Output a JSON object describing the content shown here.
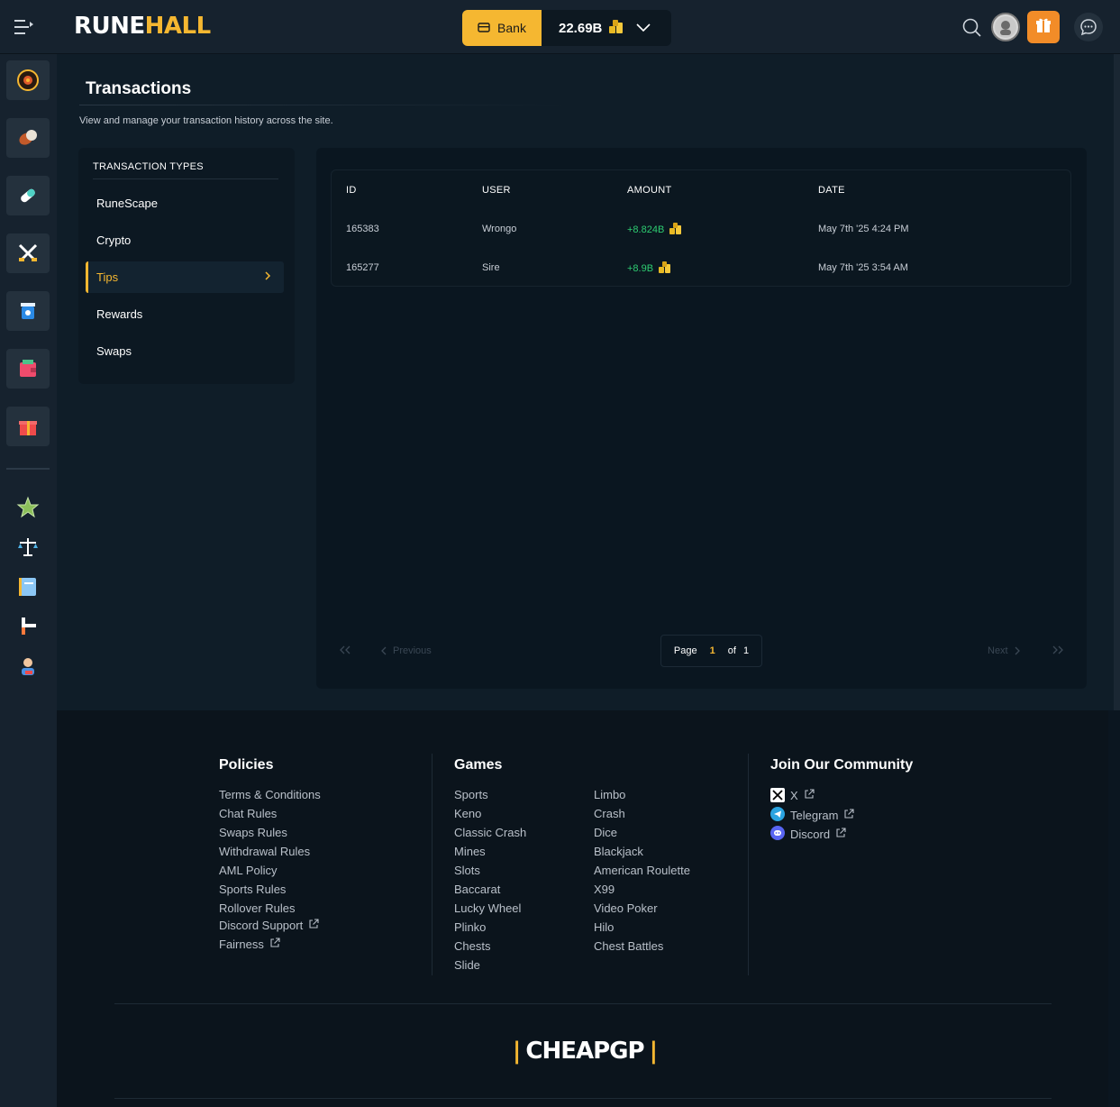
{
  "app": {
    "brand_first": "RUNE",
    "brand_second": "HALL"
  },
  "header": {
    "bank_label": "Bank",
    "balance": "22.69B"
  },
  "page": {
    "title": "Transactions",
    "subtitle": "View and manage your transaction history across the site."
  },
  "transaction_types": {
    "heading": "TRANSACTION TYPES",
    "items": [
      {
        "label": "RuneScape"
      },
      {
        "label": "Crypto"
      },
      {
        "label": "Tips"
      },
      {
        "label": "Rewards"
      },
      {
        "label": "Swaps"
      }
    ],
    "active": "Tips"
  },
  "table": {
    "columns": [
      "ID",
      "USER",
      "AMOUNT",
      "DATE"
    ],
    "rows": [
      {
        "id": "165383",
        "user": "Wrongo",
        "amount": "+8.824B",
        "date": "May 7th '25 4:24 PM"
      },
      {
        "id": "165277",
        "user": "Sire",
        "amount": "+8.9B",
        "date": "May 7th '25 3:54 AM"
      }
    ]
  },
  "pagination": {
    "previous": "Previous",
    "next": "Next",
    "page_label": "Page",
    "current": "1",
    "of_label": "of",
    "total": "1"
  },
  "footer": {
    "policies_heading": "Policies",
    "policies": [
      "Terms & Conditions",
      "Chat Rules",
      "Swaps Rules",
      "Withdrawal Rules",
      "AML Policy",
      "Sports Rules",
      "Rollover Rules",
      "Discord Support",
      "Fairness"
    ],
    "games_heading": "Games",
    "games_col1": [
      "Sports",
      "Keno",
      "Classic Crash",
      "Mines",
      "Slots",
      "Baccarat",
      "Lucky Wheel",
      "Plinko",
      "Chests",
      "Slide"
    ],
    "games_col2": [
      "Limbo",
      "Crash",
      "Dice",
      "Blackjack",
      "American Roulette",
      "X99",
      "Video Poker",
      "Hilo",
      "Chest Battles"
    ],
    "community_heading": "Join Our Community",
    "community": [
      "X",
      "Telegram",
      "Discord"
    ],
    "logo_text": "CHEAPGP"
  },
  "colors": {
    "accent": "#f5b731",
    "gift": "#f28c28",
    "positive": "#2ecc71"
  }
}
